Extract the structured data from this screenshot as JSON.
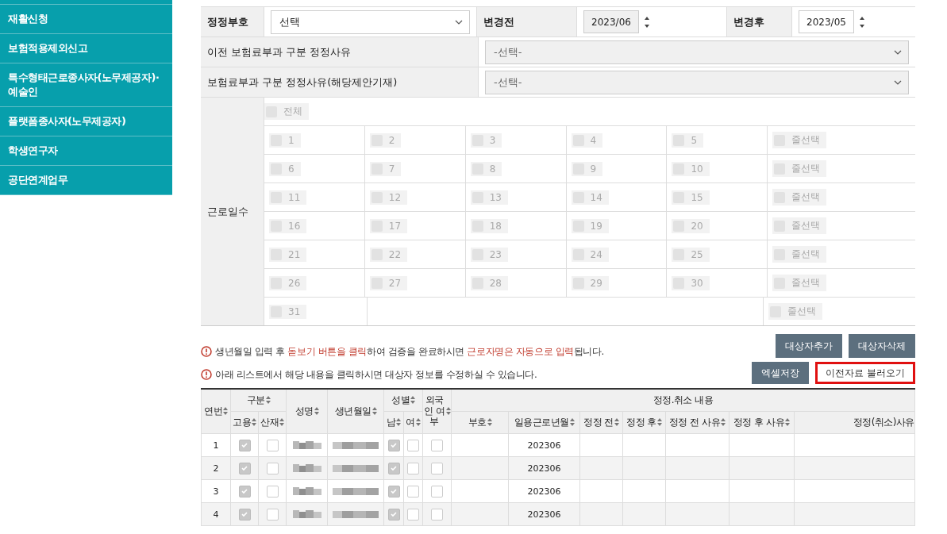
{
  "sidebar": {
    "items": [
      {
        "label": "재활신청"
      },
      {
        "label": "보험적용제외신고"
      },
      {
        "label": "특수형태근로종사자(노무제공자)·예술인"
      },
      {
        "label": "플랫폼종사자(노무제공자)"
      },
      {
        "label": "학생연구자"
      },
      {
        "label": "공단연계업무"
      }
    ]
  },
  "form": {
    "correction_code": {
      "label": "정정부호",
      "select": "선택"
    },
    "before": {
      "label": "변경전",
      "value": "2023/06",
      "disabled": true
    },
    "after": {
      "label": "변경후",
      "value": "2023/05",
      "disabled": false
    },
    "reason_rows": [
      {
        "label": "이전 보험료부과 구분 정정사유",
        "select": "-선택-",
        "disabled": true
      },
      {
        "label": "보험료부과 구분 정정사유(해당제안기재)",
        "select": "-선택-",
        "disabled": true
      }
    ],
    "work_days": {
      "label": "근로일수",
      "all": {
        "label": "전체",
        "checked": false
      },
      "rows": [
        {
          "days": [
            {
              "label": "1",
              "checked": false
            },
            {
              "label": "2",
              "checked": false
            },
            {
              "label": "3",
              "checked": false
            },
            {
              "label": "4",
              "checked": false
            },
            {
              "label": "5",
              "checked": false
            }
          ],
          "row_select": {
            "label": "줄선택",
            "checked": false
          }
        },
        {
          "days": [
            {
              "label": "6",
              "checked": false
            },
            {
              "label": "7",
              "checked": false
            },
            {
              "label": "8",
              "checked": false
            },
            {
              "label": "9",
              "checked": false
            },
            {
              "label": "10",
              "checked": false
            }
          ],
          "row_select": {
            "label": "줄선택",
            "checked": false
          }
        },
        {
          "days": [
            {
              "label": "11",
              "checked": false
            },
            {
              "label": "12",
              "checked": false
            },
            {
              "label": "13",
              "checked": false
            },
            {
              "label": "14",
              "checked": false
            },
            {
              "label": "15",
              "checked": false
            }
          ],
          "row_select": {
            "label": "줄선택",
            "checked": false
          }
        },
        {
          "days": [
            {
              "label": "16",
              "checked": false
            },
            {
              "label": "17",
              "checked": false
            },
            {
              "label": "18",
              "checked": false
            },
            {
              "label": "19",
              "checked": false
            },
            {
              "label": "20",
              "checked": false
            }
          ],
          "row_select": {
            "label": "줄선택",
            "checked": false
          }
        },
        {
          "days": [
            {
              "label": "21",
              "checked": false
            },
            {
              "label": "22",
              "checked": false
            },
            {
              "label": "23",
              "checked": false
            },
            {
              "label": "24",
              "checked": false
            },
            {
              "label": "25",
              "checked": false
            }
          ],
          "row_select": {
            "label": "줄선택",
            "checked": false
          }
        },
        {
          "days": [
            {
              "label": "26",
              "checked": false
            },
            {
              "label": "27",
              "checked": false
            },
            {
              "label": "28",
              "checked": false
            },
            {
              "label": "29",
              "checked": false
            },
            {
              "label": "30",
              "checked": false
            }
          ],
          "row_select": {
            "label": "줄선택",
            "checked": false
          }
        },
        {
          "days": [
            {
              "label": "31",
              "checked": false
            }
          ],
          "row_select": {
            "label": "줄선택",
            "checked": false
          }
        }
      ]
    }
  },
  "notices": [
    {
      "text": "생년월일 입력 후 **돋보기 버튼을 클릭**하여 검증을 완료하시면 **근로자명은 자동으로 입력**됩니다.",
      "buttons": [
        {
          "label": "대상자추가",
          "highlighted": false
        },
        {
          "label": "대상자삭제",
          "highlighted": false
        }
      ]
    },
    {
      "text": "아래 리스트에서 해당 내용을 클릭하시면 대상자 정보를 수정하실 수 있습니다.",
      "buttons": [
        {
          "label": "엑셀저장",
          "highlighted": false
        },
        {
          "label": "이전자료 불러오기",
          "highlighted": true
        }
      ]
    }
  ],
  "table": {
    "header_top": [
      {
        "label": "연번",
        "rowspan": 2,
        "sortable": true
      },
      {
        "label": "구분",
        "colspan": 2,
        "sortable": true
      },
      {
        "label": "성명",
        "rowspan": 2,
        "sortable": true
      },
      {
        "label": "생년월일",
        "rowspan": 2,
        "sortable": true
      },
      {
        "label": "성별",
        "colspan": 2,
        "sortable": true
      },
      {
        "label": "외국인 여부",
        "rowspan": 2,
        "sortable": true
      },
      {
        "label": "정정.취소 내용",
        "colspan": 7,
        "sortable": false
      }
    ],
    "header_bottom": [
      {
        "label": "고용",
        "sortable": true
      },
      {
        "label": "산재",
        "sortable": true
      },
      {
        "label": "남",
        "sortable": true
      },
      {
        "label": "여",
        "sortable": true
      },
      {
        "label": "부호",
        "sortable": true
      },
      {
        "label": "일용근로년월",
        "sortable": true
      },
      {
        "label": "정정 전",
        "sortable": true
      },
      {
        "label": "정정 후",
        "sortable": true
      },
      {
        "label": "정정 전 사유",
        "sortable": true
      },
      {
        "label": "정정 후 사유",
        "sortable": true
      },
      {
        "label": "정정(취소)사유",
        "sortable": false
      }
    ],
    "rows": [
      {
        "no": "1",
        "employment": true,
        "accident": false,
        "male": true,
        "female": false,
        "foreign": false,
        "work_month": "202306"
      },
      {
        "no": "2",
        "employment": true,
        "accident": false,
        "male": true,
        "female": false,
        "foreign": false,
        "work_month": "202306"
      },
      {
        "no": "3",
        "employment": true,
        "accident": false,
        "male": true,
        "female": false,
        "foreign": false,
        "work_month": "202306"
      },
      {
        "no": "4",
        "employment": true,
        "accident": false,
        "male": true,
        "female": false,
        "foreign": false,
        "work_month": "202306"
      }
    ]
  }
}
